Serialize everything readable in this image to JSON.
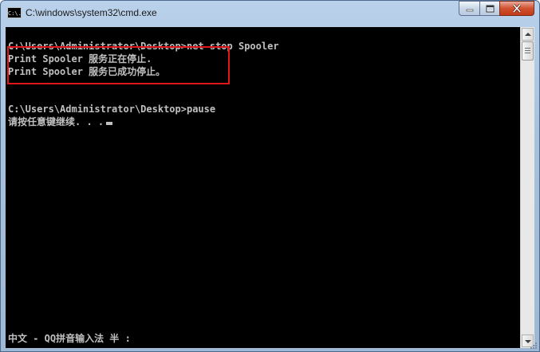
{
  "window": {
    "title": "C:\\windows\\system32\\cmd.exe",
    "icon": "cmd-app-icon",
    "icon_text": "C:\\."
  },
  "console": {
    "lines": [
      "C:\\Users\\Administrator\\Desktop>net stop Spooler",
      "Print Spooler 服务正在停止.",
      "Print Spooler 服务已成功停止。",
      "",
      "C:\\Users\\Administrator\\Desktop>pause",
      "请按任意键继续. . ."
    ],
    "ime_status": "中文 - QQ拼音输入法 半 :"
  },
  "colors": {
    "console_bg": "#000000",
    "console_text": "#c0c0c0",
    "highlight_box": "#e0161b",
    "close_button": "#c23a16"
  }
}
